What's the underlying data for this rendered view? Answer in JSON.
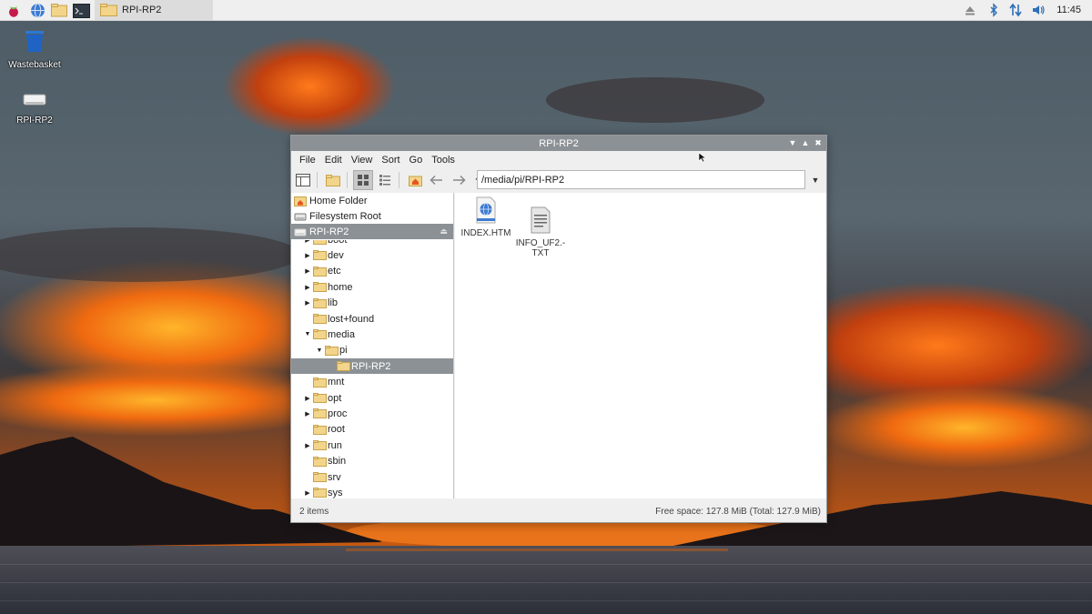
{
  "taskbar": {
    "launchers": [
      "raspberry-menu-icon",
      "web-browser-icon",
      "file-manager-icon",
      "terminal-icon"
    ],
    "task_label": "RPI-RP2",
    "tray_icons": [
      "eject-icon",
      "bluetooth-icon",
      "network-icon",
      "volume-icon"
    ],
    "clock": "11:45"
  },
  "desktop": {
    "icons": [
      {
        "label": "Wastebasket",
        "icon": "wastebasket-icon"
      },
      {
        "label": "RPI-RP2",
        "icon": "drive-icon"
      }
    ]
  },
  "window": {
    "title": "RPI-RP2",
    "menu": [
      "File",
      "Edit",
      "View",
      "Sort",
      "Go",
      "Tools"
    ],
    "path": "/media/pi/RPI-RP2",
    "places": [
      {
        "label": "Home Folder",
        "icon": "home-folder-icon"
      },
      {
        "label": "Filesystem Root",
        "icon": "filesystem-root-icon"
      },
      {
        "label": "RPI-RP2",
        "icon": "drive-icon",
        "selected": true
      }
    ],
    "tree": [
      {
        "label": "boot",
        "expander": "collapsed",
        "depth": 0
      },
      {
        "label": "dev",
        "expander": "collapsed",
        "depth": 0
      },
      {
        "label": "etc",
        "expander": "collapsed",
        "depth": 0
      },
      {
        "label": "home",
        "expander": "collapsed",
        "depth": 0
      },
      {
        "label": "lib",
        "expander": "collapsed",
        "depth": 0
      },
      {
        "label": "lost+found",
        "expander": "none",
        "depth": 0
      },
      {
        "label": "media",
        "expander": "expanded",
        "depth": 0
      },
      {
        "label": "pi",
        "expander": "expanded",
        "depth": 1
      },
      {
        "label": "RPI-RP2",
        "expander": "none",
        "depth": 2,
        "selected": true
      },
      {
        "label": "mnt",
        "expander": "none",
        "depth": 0
      },
      {
        "label": "opt",
        "expander": "collapsed",
        "depth": 0
      },
      {
        "label": "proc",
        "expander": "collapsed",
        "depth": 0
      },
      {
        "label": "root",
        "expander": "none",
        "depth": 0
      },
      {
        "label": "run",
        "expander": "collapsed",
        "depth": 0
      },
      {
        "label": "sbin",
        "expander": "none",
        "depth": 0
      },
      {
        "label": "srv",
        "expander": "none",
        "depth": 0
      },
      {
        "label": "sys",
        "expander": "collapsed",
        "depth": 0
      }
    ],
    "files": [
      {
        "name": "INDEX.HTM",
        "icon": "html-file-icon"
      },
      {
        "name": "INFO_UF2.-\nTXT",
        "icon": "text-file-icon"
      }
    ],
    "status_left": "2 items",
    "status_right": "Free space: 127.8 MiB (Total: 127.9 MiB)"
  },
  "colors": {
    "selection": "#8c9196",
    "folder": "#f2d58a",
    "taskbar": "#efefef"
  }
}
